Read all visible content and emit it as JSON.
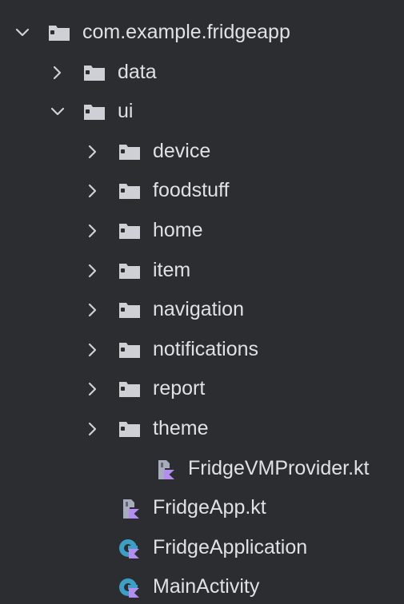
{
  "colors": {
    "background": "#2b2d30",
    "text": "#dfe1e5",
    "chevron": "#ced0d6",
    "folder": "#ced0d6",
    "kotlin_file_gray": "#a8adbd",
    "kotlin_file_purple": "#b38df0",
    "class_icon_teal": "#3e9fc4"
  },
  "tree": [
    {
      "label": "com.example.fridgeapp",
      "level": 0,
      "chevron": "expanded",
      "icon": "folder-icon",
      "name": "package-com-example-fridgeapp"
    },
    {
      "label": "data",
      "level": 1,
      "chevron": "collapsed",
      "icon": "folder-icon",
      "name": "folder-data"
    },
    {
      "label": "ui",
      "level": 1,
      "chevron": "expanded",
      "icon": "folder-icon",
      "name": "folder-ui"
    },
    {
      "label": "device",
      "level": 2,
      "chevron": "collapsed",
      "icon": "folder-icon",
      "name": "folder-device"
    },
    {
      "label": "foodstuff",
      "level": 2,
      "chevron": "collapsed",
      "icon": "folder-icon",
      "name": "folder-foodstuff"
    },
    {
      "label": "home",
      "level": 2,
      "chevron": "collapsed",
      "icon": "folder-icon",
      "name": "folder-home"
    },
    {
      "label": "item",
      "level": 2,
      "chevron": "collapsed",
      "icon": "folder-icon",
      "name": "folder-item"
    },
    {
      "label": "navigation",
      "level": 2,
      "chevron": "collapsed",
      "icon": "folder-icon",
      "name": "folder-navigation"
    },
    {
      "label": "notifications",
      "level": 2,
      "chevron": "collapsed",
      "icon": "folder-icon",
      "name": "folder-notifications"
    },
    {
      "label": "report",
      "level": 2,
      "chevron": "collapsed",
      "icon": "folder-icon",
      "name": "folder-report"
    },
    {
      "label": "theme",
      "level": 2,
      "chevron": "collapsed",
      "icon": "folder-icon",
      "name": "folder-theme"
    },
    {
      "label": "FridgeVMProvider.kt",
      "level": 3,
      "chevron": "none",
      "icon": "kotlin-file-icon",
      "name": "file-fridgevmprovider-kt"
    },
    {
      "label": "FridgeApp.kt",
      "level": 2,
      "chevron": "none",
      "icon": "kotlin-file-icon",
      "name": "file-fridgeapp-kt"
    },
    {
      "label": "FridgeApplication",
      "level": 2,
      "chevron": "none",
      "icon": "kotlin-class-icon",
      "name": "class-fridgeapplication"
    },
    {
      "label": "MainActivity",
      "level": 2,
      "chevron": "none",
      "icon": "kotlin-class-icon",
      "name": "class-mainactivity"
    }
  ]
}
